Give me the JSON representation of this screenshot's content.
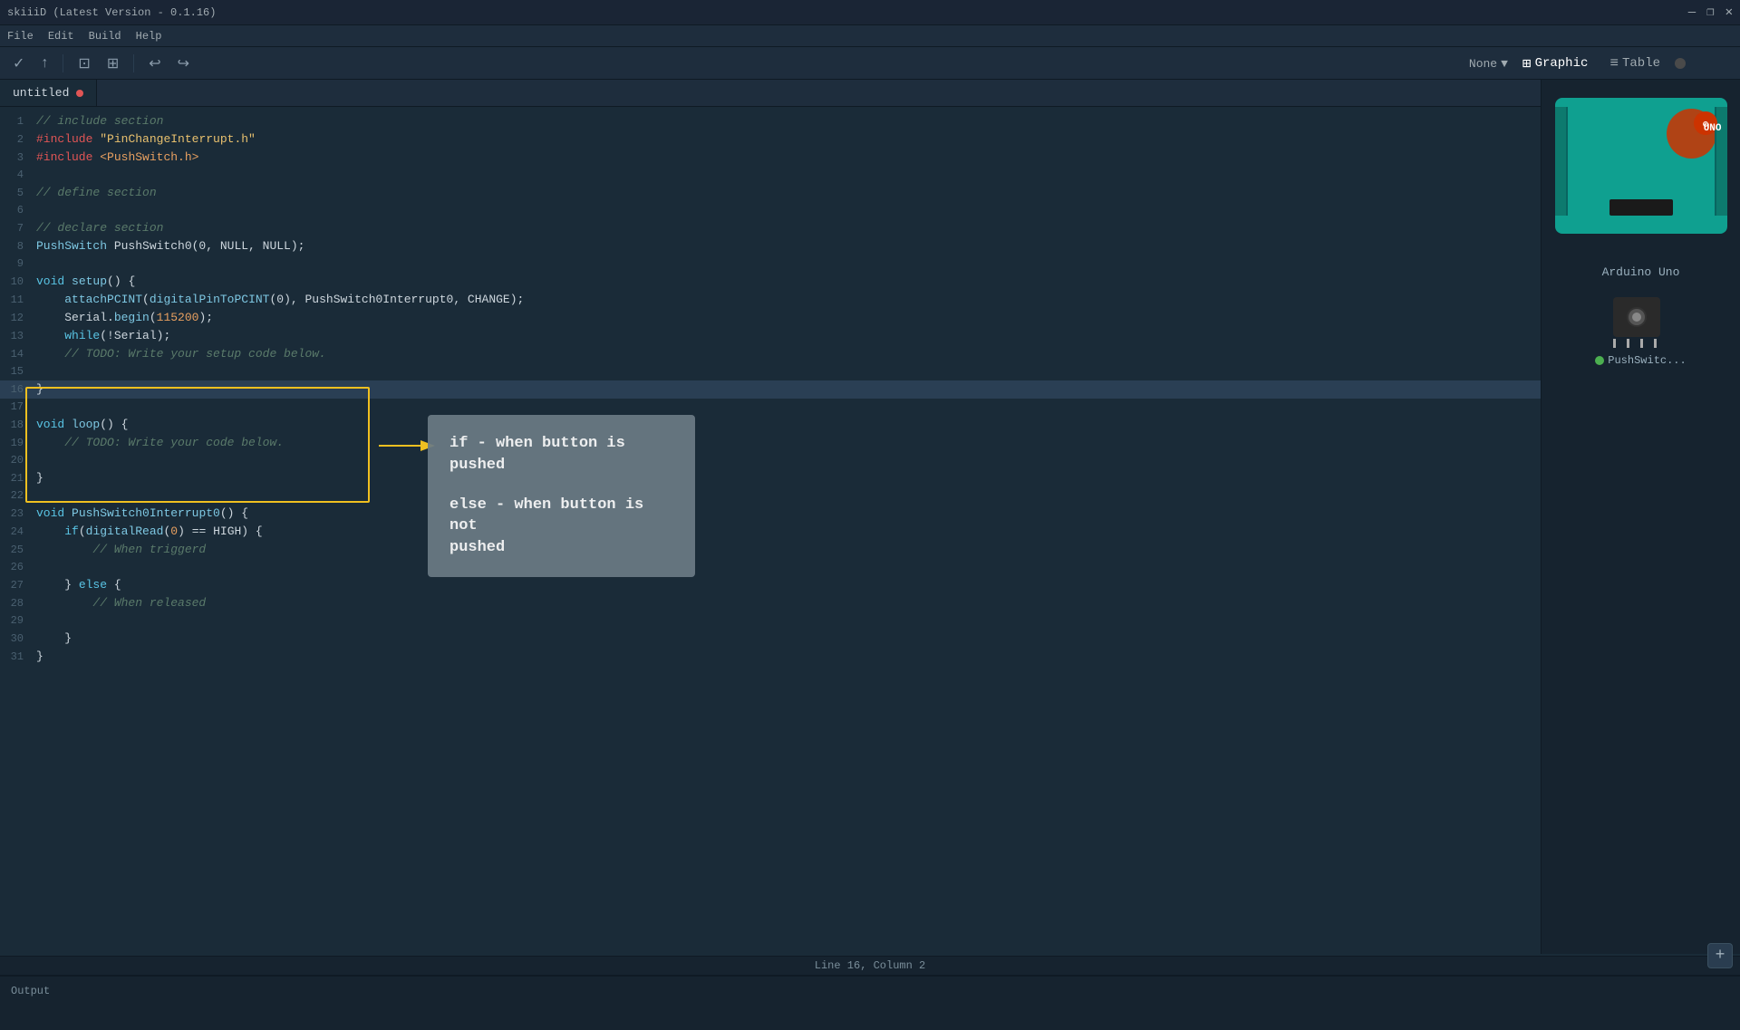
{
  "window": {
    "title": "skiiiD (Latest Version - 0.1.16)",
    "controls": [
      "—",
      "❐",
      "✕"
    ]
  },
  "menu": {
    "items": [
      "File",
      "Edit",
      "Build",
      "Help"
    ]
  },
  "toolbar": {
    "buttons": [
      "✓",
      "↑",
      "⊡",
      "⊞",
      "↩",
      "↪"
    ]
  },
  "tab": {
    "name": "untitled",
    "modified": true
  },
  "view_toggle": {
    "none_label": "None",
    "graphic_label": "Graphic",
    "table_label": "Table"
  },
  "code": {
    "lines": [
      {
        "num": 1,
        "text": "// include section",
        "type": "comment"
      },
      {
        "num": 2,
        "text": "#include \"PinChangeInterrupt.h\"",
        "type": "include"
      },
      {
        "num": 3,
        "text": "#include <PushSwitch.h>",
        "type": "include"
      },
      {
        "num": 4,
        "text": "",
        "type": "normal"
      },
      {
        "num": 5,
        "text": "// define section",
        "type": "comment"
      },
      {
        "num": 6,
        "text": "",
        "type": "normal"
      },
      {
        "num": 7,
        "text": "// declare section",
        "type": "comment"
      },
      {
        "num": 8,
        "text": "PushSwitch PushSwitch0(0, NULL, NULL);",
        "type": "normal"
      },
      {
        "num": 9,
        "text": "",
        "type": "normal"
      },
      {
        "num": 10,
        "text": "void setup() {",
        "type": "normal"
      },
      {
        "num": 11,
        "text": "    attachPCINT(digitalPinToPCINT(0), PushSwitch0Interrupt0, CHANGE);",
        "type": "normal"
      },
      {
        "num": 12,
        "text": "    Serial.begin(115200);",
        "type": "normal"
      },
      {
        "num": 13,
        "text": "    while(!Serial);",
        "type": "normal"
      },
      {
        "num": 14,
        "text": "    // TODO: Write your setup code below.",
        "type": "comment"
      },
      {
        "num": 15,
        "text": "",
        "type": "normal"
      },
      {
        "num": 16,
        "text": "}",
        "type": "highlighted"
      },
      {
        "num": 17,
        "text": "",
        "type": "normal"
      },
      {
        "num": 18,
        "text": "void loop() {",
        "type": "normal"
      },
      {
        "num": 19,
        "text": "    // TODO: Write your code below.",
        "type": "comment"
      },
      {
        "num": 20,
        "text": "",
        "type": "normal"
      },
      {
        "num": 21,
        "text": "}",
        "type": "normal"
      },
      {
        "num": 22,
        "text": "",
        "type": "normal"
      },
      {
        "num": 23,
        "text": "void PushSwitch0Interrupt0() {",
        "type": "normal"
      },
      {
        "num": 24,
        "text": "    if(digitalRead(0) == HIGH) {",
        "type": "normal"
      },
      {
        "num": 25,
        "text": "        // When triggerd",
        "type": "comment"
      },
      {
        "num": 26,
        "text": "",
        "type": "normal"
      },
      {
        "num": 27,
        "text": "    } else {",
        "type": "normal"
      },
      {
        "num": 28,
        "text": "        // When released",
        "type": "comment"
      },
      {
        "num": 29,
        "text": "",
        "type": "normal"
      },
      {
        "num": 30,
        "text": "    }",
        "type": "normal"
      },
      {
        "num": 31,
        "text": "}",
        "type": "normal"
      }
    ]
  },
  "annotation": {
    "line1": "if - when button is pushed",
    "line2": "else - when button is not",
    "line3": "pushed"
  },
  "right_panel": {
    "arduino_name": "Arduino Uno",
    "pushswitch_label": "PushSwitc..."
  },
  "status_bar": {
    "text": "Line 16, Column 2"
  },
  "output": {
    "label": "Output"
  },
  "plus_button": {
    "label": "+"
  }
}
